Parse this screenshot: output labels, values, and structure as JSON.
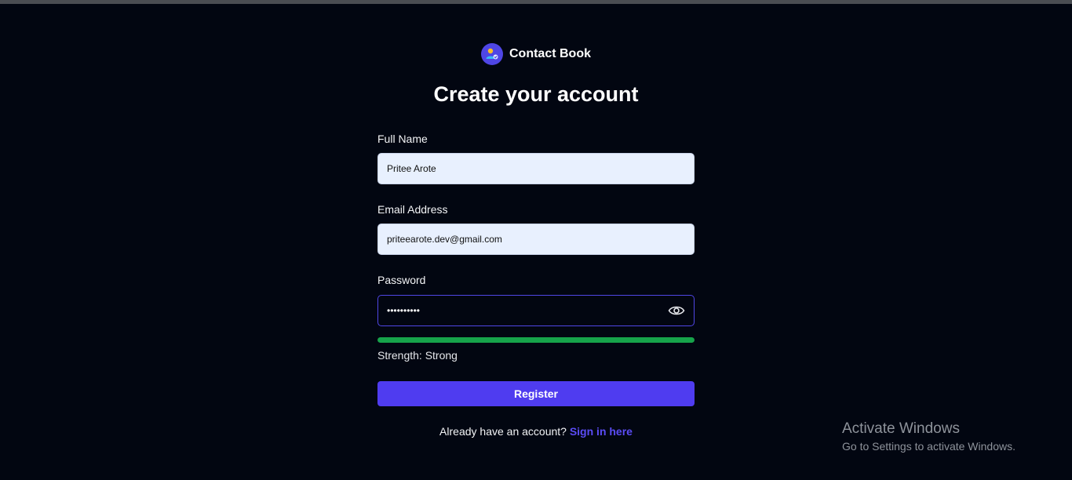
{
  "brand": {
    "name": "Contact Book",
    "logo_icon": "contact-book-icon",
    "logo_color": "#4f46e5"
  },
  "page": {
    "title": "Create your account"
  },
  "form": {
    "full_name": {
      "label": "Full Name",
      "value": "Pritee Arote"
    },
    "email": {
      "label": "Email Address",
      "value": "priteearote.dev@gmail.com"
    },
    "password": {
      "label": "Password",
      "value": "••••••••••",
      "toggle_icon": "eye-icon"
    },
    "strength": {
      "text": "Strength: Strong",
      "level": 1.0,
      "color": "#16a34a"
    },
    "register_label": "Register",
    "register_color": "#4f3cf0"
  },
  "footer": {
    "prompt": "Already have an account?",
    "link_label": "Sign in here",
    "link_color": "#5b4cf5"
  },
  "watermark": {
    "title": "Activate Windows",
    "subtitle": "Go to Settings to activate Windows."
  }
}
